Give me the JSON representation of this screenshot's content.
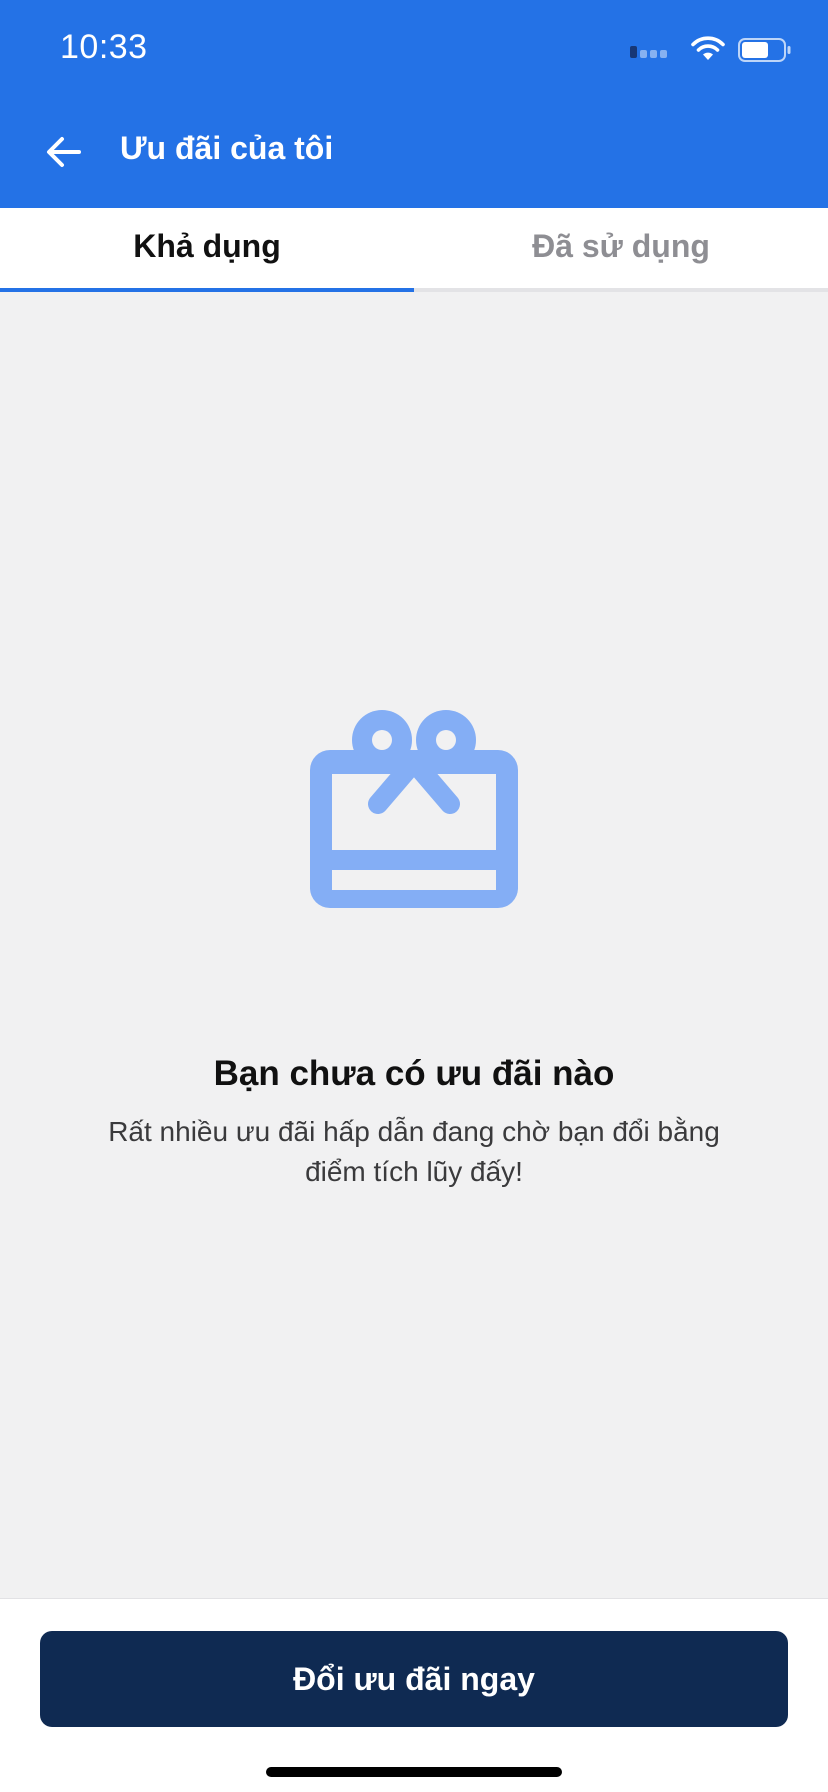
{
  "status_bar": {
    "time": "10:33"
  },
  "nav": {
    "title": "Ưu đãi của tôi",
    "back_icon": "arrow-left-icon"
  },
  "tabs": [
    {
      "label": "Khả dụng",
      "active": true
    },
    {
      "label": "Đã sử dụng",
      "active": false
    }
  ],
  "empty_state": {
    "icon": "gift-card-icon",
    "title": "Bạn chưa có ưu đãi nào",
    "description": "Rất nhiều ưu đãi hấp dẫn đang chờ bạn đổi bằng điểm tích lũy đấy!"
  },
  "footer": {
    "cta_label": "Đổi ưu đãi ngay"
  },
  "colors": {
    "primary": "#2472e6",
    "cta": "#0f2a52",
    "icon": "#84aef5",
    "background": "#f1f1f2"
  }
}
